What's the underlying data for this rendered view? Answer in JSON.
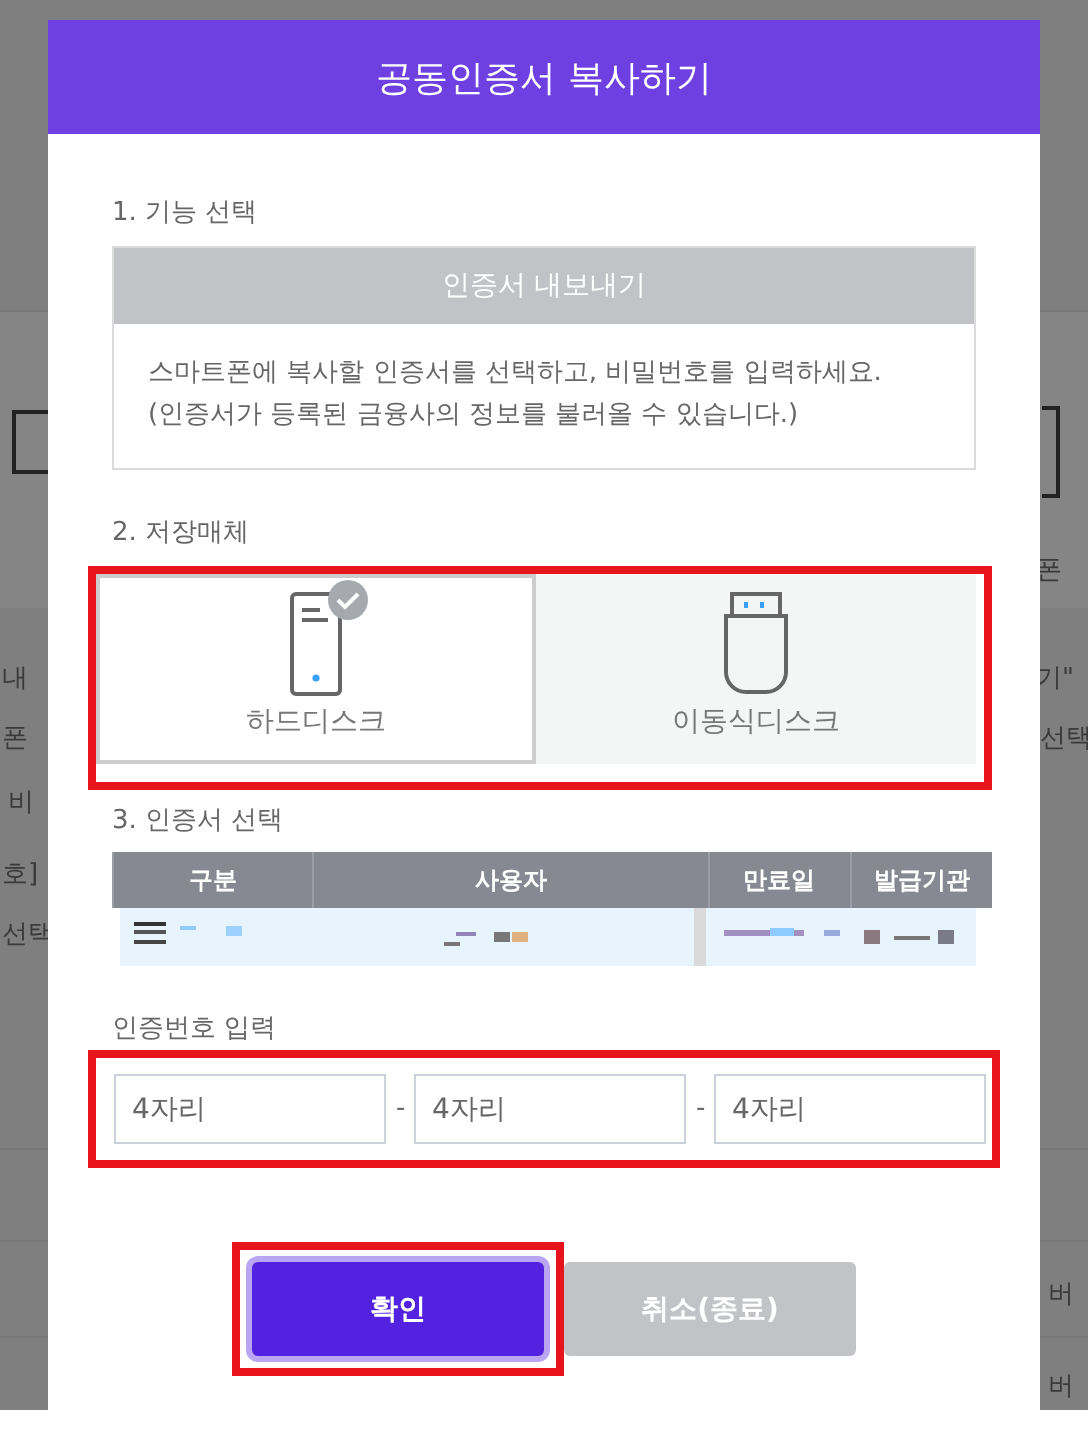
{
  "background": {
    "left_fragments": [
      "내",
      "폰",
      "비",
      "호]",
      "선택"
    ],
    "right_fragments": [
      "폰",
      "기\"",
      "선택",
      "버",
      "버"
    ]
  },
  "dialog": {
    "title": "공동인증서 복사하기",
    "function_section": {
      "label": "1. 기능 선택",
      "option": "인증서 내보내기",
      "description": "스마트폰에 복사할 인증서를 선택하고, 비밀번호를 입력하세요.\n(인증서가 등록된 금융사의 정보를 불러올 수 있습니다.)"
    },
    "storage_section": {
      "label": "2. 저장매체",
      "highlighted": true,
      "options": [
        {
          "label": "하드디스크",
          "kind": "harddisk",
          "selected": true
        },
        {
          "label": "이동식디스크",
          "kind": "usb",
          "selected": false
        }
      ]
    },
    "certificate_section": {
      "label": "3. 인증서 선택",
      "columns": [
        "구분",
        "사용자",
        "만료일",
        "발급기관"
      ],
      "rows": [
        {
          "kind": "redacted",
          "selected": true
        }
      ]
    },
    "code_section": {
      "label": "인증번호 입력",
      "highlighted": true,
      "fields": [
        {
          "placeholder": "4자리"
        },
        {
          "placeholder": "4자리"
        },
        {
          "placeholder": "4자리"
        }
      ],
      "separator": "-"
    },
    "buttons": [
      {
        "label": "확인",
        "kind": "primary",
        "focused": true,
        "highlighted": true
      },
      {
        "label": "취소(종료)",
        "kind": "secondary",
        "focused": false,
        "highlighted": false
      }
    ]
  }
}
